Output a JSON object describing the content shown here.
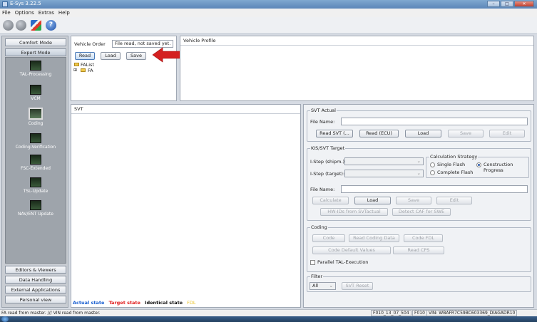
{
  "window": {
    "title": "E-Sys 3.22.5"
  },
  "menu": [
    "File",
    "Options",
    "Extras",
    "Help"
  ],
  "toolbar": {
    "icons": [
      "connect-icon",
      "disconnect-icon",
      "tools-icon",
      "help-icon"
    ]
  },
  "left_nav": {
    "comfort_mode": "Comfort Mode",
    "expert_mode": "Expert Mode",
    "modes": [
      "TAL-Processing",
      "VCM",
      "Coding",
      "Coding-Verification",
      "FSC-Extended",
      "TSL-Update",
      "NAV/ENT Update"
    ],
    "selected_mode": "Coding",
    "bottom_buttons": [
      "Editors & Viewers",
      "Data Handling",
      "External Applications",
      "Personal view"
    ]
  },
  "vehicle_order": {
    "label": "Vehicle Order",
    "status": "File read, not saved yet.",
    "read": "Read",
    "load": "Load",
    "save": "Save",
    "tree": [
      "FAList",
      "FA"
    ]
  },
  "vehicle_profile": {
    "label": "Vehicle Profile"
  },
  "svt": {
    "label": "SVT",
    "legend": {
      "actual": "Actual state",
      "target": "Target state",
      "identical": "Identical state",
      "fdl": "FDL"
    }
  },
  "svt_actual": {
    "label": "SVT Actual",
    "file_name_label": "File Name:",
    "file_name_value": "",
    "read_svt": "Read SVT (...",
    "read_ecu": "Read (ECU)",
    "load": "Load",
    "save": "Save",
    "edit": "Edit"
  },
  "kis_target": {
    "label": "KIS/SVT Target",
    "istep_shipm_label": "I-Step (shipm.):",
    "istep_target_label": "I-Step (target):",
    "calc_strategy_label": "Calculation Strategy",
    "single_flash": "Single Flash",
    "construction_progress": "Construction Progress",
    "complete_flash": "Complete Flash",
    "selected_strategy": "Construction Progress",
    "file_name_label": "File Name:",
    "calculate": "Calculate",
    "load": "Load",
    "save": "Save",
    "edit": "Edit",
    "hw_ids": "HW-IDs from SVTactual",
    "detect_caf": "Detect CAF for SWE"
  },
  "coding": {
    "label": "Coding",
    "code": "Code",
    "read_coding_data": "Read Coding Data",
    "code_fdl": "Code FDL",
    "code_default_values": "Code Default Values",
    "read_cps": "Read CPS",
    "parallel_tal": "Parallel TAL-Execution"
  },
  "filter": {
    "label": "Filter",
    "value": "All",
    "svt_reset": "SVT Reset"
  },
  "status": {
    "left": "FA read from master.  ///  VIN read from master.",
    "target": "F010_13_07_504",
    "series": "F010",
    "vin": "VIN: WBAFR7C59BC603369_DIAGADR10"
  },
  "colors": {
    "actual": "#1a5fd0",
    "target": "#e02020",
    "identical": "#111111",
    "fdl": "#e8c020",
    "arrow": "#d42020"
  }
}
